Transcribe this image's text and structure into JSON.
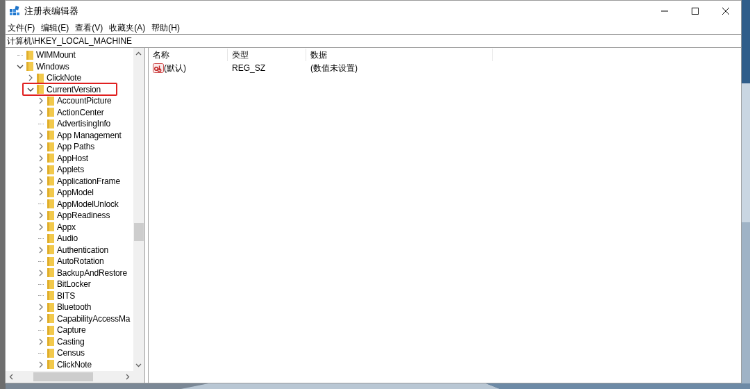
{
  "window": {
    "title": "注册表编辑器"
  },
  "menu": [
    {
      "label": "文件(F)"
    },
    {
      "label": "编辑(E)"
    },
    {
      "label": "查看(V)"
    },
    {
      "label": "收藏夹(A)"
    },
    {
      "label": "帮助(H)"
    }
  ],
  "address": "计算机\\HKEY_LOCAL_MACHINE",
  "tree": [
    {
      "label": "WIMMount",
      "expandable": false,
      "boxed": false
    },
    {
      "label": "Windows",
      "expandable": true,
      "expanded": true,
      "boxed": false,
      "children": [
        {
          "label": "ClickNote",
          "expandable": true,
          "expanded": false,
          "boxed": false
        },
        {
          "label": "CurrentVersion",
          "expandable": true,
          "expanded": true,
          "boxed": true,
          "children": [
            {
              "label": "AccountPicture",
              "expandable": true,
              "expanded": false,
              "boxed": false
            },
            {
              "label": "ActionCenter",
              "expandable": true,
              "expanded": false,
              "boxed": false
            },
            {
              "label": "AdvertisingInfo",
              "expandable": false,
              "boxed": false
            },
            {
              "label": "App Management",
              "expandable": true,
              "expanded": false,
              "boxed": false
            },
            {
              "label": "App Paths",
              "expandable": true,
              "expanded": false,
              "boxed": false
            },
            {
              "label": "AppHost",
              "expandable": true,
              "expanded": false,
              "boxed": false
            },
            {
              "label": "Applets",
              "expandable": true,
              "expanded": false,
              "boxed": false
            },
            {
              "label": "ApplicationFrame",
              "expandable": true,
              "expanded": false,
              "boxed": false
            },
            {
              "label": "AppModel",
              "expandable": true,
              "expanded": false,
              "boxed": false
            },
            {
              "label": "AppModelUnlock",
              "expandable": false,
              "boxed": false
            },
            {
              "label": "AppReadiness",
              "expandable": true,
              "expanded": false,
              "boxed": false
            },
            {
              "label": "Appx",
              "expandable": true,
              "expanded": false,
              "boxed": false
            },
            {
              "label": "Audio",
              "expandable": false,
              "boxed": false
            },
            {
              "label": "Authentication",
              "expandable": true,
              "expanded": false,
              "boxed": false
            },
            {
              "label": "AutoRotation",
              "expandable": false,
              "boxed": false
            },
            {
              "label": "BackupAndRestore",
              "expandable": true,
              "expanded": false,
              "boxed": false
            },
            {
              "label": "BitLocker",
              "expandable": false,
              "boxed": false
            },
            {
              "label": "BITS",
              "expandable": false,
              "boxed": false
            },
            {
              "label": "Bluetooth",
              "expandable": true,
              "expanded": false,
              "boxed": false
            },
            {
              "label": "CapabilityAccessMa",
              "expandable": true,
              "expanded": false,
              "boxed": false
            },
            {
              "label": "Capture",
              "expandable": false,
              "boxed": false
            },
            {
              "label": "Casting",
              "expandable": true,
              "expanded": false,
              "boxed": false
            },
            {
              "label": "Census",
              "expandable": false,
              "boxed": false
            },
            {
              "label": "ClickNote",
              "expandable": true,
              "expanded": false,
              "boxed": false
            }
          ]
        }
      ]
    }
  ],
  "values": {
    "columns": [
      "名称",
      "类型",
      "数据"
    ],
    "rows": [
      {
        "name": "(默认)",
        "type": "REG_SZ",
        "data": "(数值未设置)"
      }
    ]
  }
}
